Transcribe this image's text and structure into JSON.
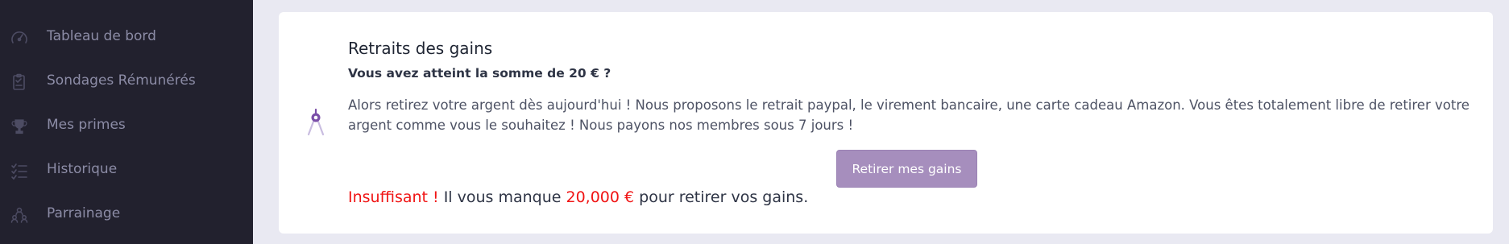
{
  "sidebar": {
    "items": [
      {
        "label": "Tableau de bord",
        "icon": "dashboard-gauge-icon"
      },
      {
        "label": "Sondages Rémunérés",
        "icon": "clipboard-survey-icon"
      },
      {
        "label": "Mes primes",
        "icon": "trophy-icon"
      },
      {
        "label": "Historique",
        "icon": "checklist-history-icon"
      },
      {
        "label": "Parrainage",
        "icon": "referral-people-icon"
      }
    ]
  },
  "card": {
    "icon": "compass-icon",
    "title": "Retraits des gains",
    "subtitle": "Vous avez atteint la somme de 20 € ?",
    "body": "Alors retirez votre argent dès aujourd'hui ! Nous proposons le retrait paypal, le virement bancaire, une carte cadeau Amazon. Vous êtes totalement libre de retirer votre argent comme vous le souhaitez ! Nous payons nos membres sous 7 jours !",
    "button_label": "Retirer mes gains",
    "status": {
      "warning": "Insuffisant !",
      "text_before": " Il vous manque ",
      "amount": "20,000 €",
      "text_after": " pour retirer vos gains."
    }
  },
  "colors": {
    "sidebar_bg": "#22212e",
    "page_bg": "#e9e9f2",
    "button_bg": "#a68ebd",
    "warning": "#f01414",
    "icon_accent": "#7b4fa8"
  }
}
